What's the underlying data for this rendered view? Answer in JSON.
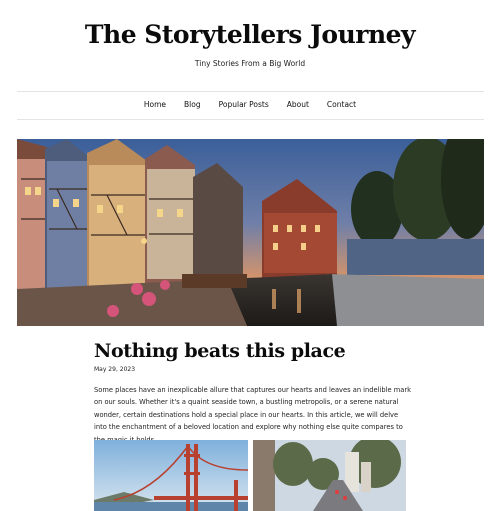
{
  "site": {
    "title": "The Storytellers Journey",
    "tagline": "Tiny Stories From a Big World"
  },
  "nav": {
    "items": [
      "Home",
      "Blog",
      "Popular Posts",
      "About",
      "Contact"
    ]
  },
  "hero": {
    "description": "Colorful half-timbered houses along a canal at dusk"
  },
  "post": {
    "title": "Nothing beats this place",
    "date": "May 29, 2023",
    "body": "Some places have an inexplicable allure that captures our hearts and leaves an indelible mark on our souls. Whether it's a quaint seaside town, a bustling metropolis, or a serene natural wonder, certain destinations hold a special place in our hearts. In this article, we will delve into the enchantment of a beloved location and explore why nothing else quite compares to the magic it holds."
  },
  "colors": {
    "text": "#111111",
    "rule": "#e4e4e4"
  }
}
